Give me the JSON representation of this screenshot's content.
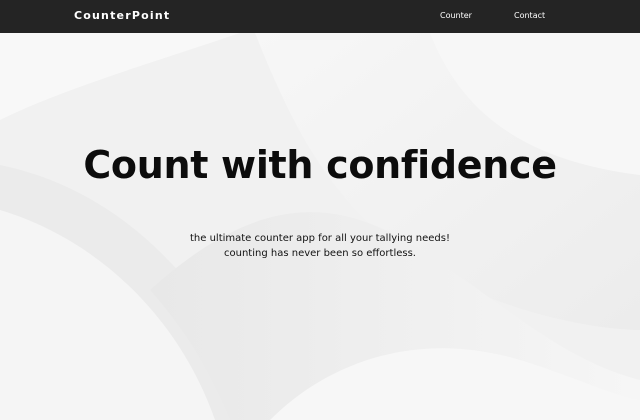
{
  "navbar": {
    "brand": "CounterPoint",
    "links": [
      {
        "label": "Counter"
      },
      {
        "label": "Contact"
      }
    ]
  },
  "hero": {
    "title": "Count with confidence",
    "subtitle_lines": [
      "the ultimate counter app for all your tallying needs!",
      "counting has never been so effortless."
    ]
  },
  "colors": {
    "navbar_bg": "#242424",
    "page_bg": "#f2f2f2",
    "text_dark": "#0c0c0c"
  }
}
